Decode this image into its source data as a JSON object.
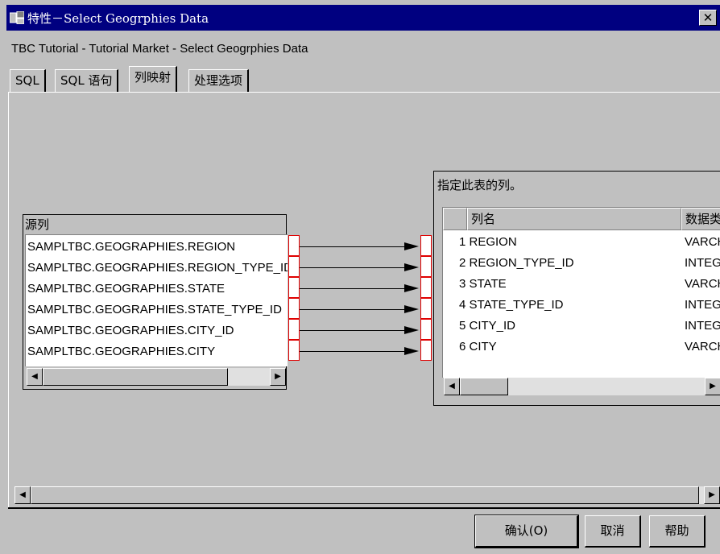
{
  "window": {
    "title": "特性－Select Geogrphies Data",
    "close_label": "✕",
    "subtitle": "TBC Tutorial - Tutorial Market - Select Geogrphies Data"
  },
  "tabs": [
    {
      "label": "SQL"
    },
    {
      "label": "SQL 语句"
    },
    {
      "label": "列映射"
    },
    {
      "label": "处理选项"
    }
  ],
  "source": {
    "label": "源列",
    "items": [
      "SAMPLTBC.GEOGRAPHIES.REGION",
      "SAMPLTBC.GEOGRAPHIES.REGION_TYPE_ID",
      "SAMPLTBC.GEOGRAPHIES.STATE",
      "SAMPLTBC.GEOGRAPHIES.STATE_TYPE_ID",
      "SAMPLTBC.GEOGRAPHIES.CITY_ID",
      "SAMPLTBC.GEOGRAPHIES.CITY"
    ]
  },
  "target": {
    "label": "指定此表的列。",
    "columns": [
      "列名",
      "数据类型"
    ],
    "rows": [
      {
        "name": "1 REGION",
        "type": "VARCHAR"
      },
      {
        "name": "2 REGION_TYPE_ID",
        "type": "INTEGER"
      },
      {
        "name": "3 STATE",
        "type": "VARCHAR"
      },
      {
        "name": "4 STATE_TYPE_ID",
        "type": "INTEGER"
      },
      {
        "name": "5 CITY_ID",
        "type": "INTEGER"
      },
      {
        "name": "6 CITY",
        "type": "VARCHAR"
      }
    ]
  },
  "scroll": {
    "left_arrow": "◀",
    "right_arrow": "▶"
  },
  "buttons": {
    "ok": "确认(O)",
    "cancel": "取消",
    "help": "帮助"
  }
}
